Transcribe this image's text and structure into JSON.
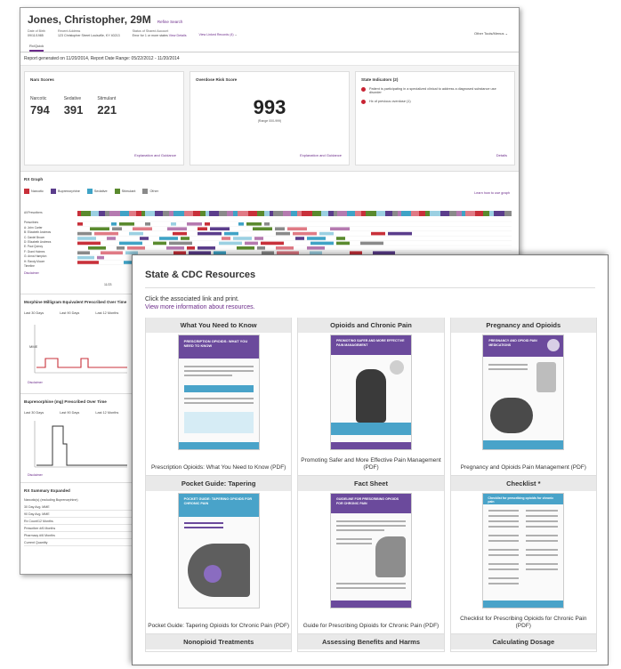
{
  "patient": {
    "name": "Jones, Christopher, 29M",
    "refine_link": "Refine Search",
    "dob_label": "Date of Birth",
    "dob": "09/11/1985",
    "address_label": "Recent Address",
    "address": "123 Christopher Street Louisville, KY 40213",
    "status_label": "Status of Shared Account",
    "status": "Error for 1 or more states",
    "view_details": "View Details",
    "linked_records": "View Linked Records (4)",
    "other_tools": "Other Tools/Menus",
    "tab": "Rx/Quick"
  },
  "report_line": "Report generated on 11/20/2014, Report Date Range: 05/22/2012 - 11/20/2014",
  "narx": {
    "title": "Narx Scores",
    "scores": [
      {
        "label": "Narcotic",
        "value": "794"
      },
      {
        "label": "Sedative",
        "value": "391"
      },
      {
        "label": "Stimulant",
        "value": "221"
      }
    ],
    "link": "Explanation and Guidance"
  },
  "overdose": {
    "title": "Overdose Risk Score",
    "value": "993",
    "range": "(Range 000-999)",
    "link": "Explanation and Guidance"
  },
  "state_indicators": {
    "title": "State Indicators (2)",
    "items": [
      "Patient is participating in a specialized clinical to address a diagnosed substance use disorder",
      "Hx of previous overdose (1)"
    ],
    "link": "Details"
  },
  "rx_graph": {
    "title": "RX Graph",
    "legend": [
      {
        "label": "Narcotic",
        "color": "#c8303a"
      },
      {
        "label": "Buprenorphine",
        "color": "#5b3d8c"
      },
      {
        "label": "Sedative",
        "color": "#3fa3c6"
      },
      {
        "label": "Stimulant",
        "color": "#5a8a2e"
      },
      {
        "label": "Other",
        "color": "#8a8a8a"
      }
    ],
    "learn_link": "Learn how to use graph",
    "all_label": "All Prescribers",
    "prescriber_header": "Prescribers",
    "prescribers": [
      "A: John Carter",
      "B: Elizabeth Andrews",
      "C: Daniel Brown",
      "D: Elizabeth Andrews",
      "E: Paul Quincy",
      "F: Grant Holmes",
      "G: Anna Hampton",
      "H: Randy Moore"
    ],
    "timeline_label": "Timeline",
    "timeline_year": "11/23",
    "disclaimer": "Disclaimer"
  },
  "mme": {
    "title": "Morphine Milligram Equivalent Prescribed Over Time",
    "tabs": [
      "Last 30 Days",
      "Last 90 Days",
      "Last 12 Months"
    ],
    "y_label": "MME",
    "disclaimer": "Disclaimer"
  },
  "buprenorphine": {
    "title": "Buprenorphine (mg) Prescribed Over Time",
    "tabs": [
      "Last 30 Days",
      "Last 90 Days",
      "Last 12 Months"
    ],
    "disclaimer": "Disclaimer"
  },
  "rx_summary": {
    "title": "RX Summary Expanded",
    "sub": "Narcotic(s) (excluding Buprenorphine)",
    "rows": [
      "30 Day Avg. MME",
      "90 Day Avg. MME",
      "Rx Count/12 Months",
      "Prescriber #/6 Months",
      "Pharmacy #/6 Months",
      "Current Quantity"
    ]
  },
  "resources": {
    "title": "State & CDC Resources",
    "instruction": "Click the associated link and print.",
    "more_link": "View more information about resources.",
    "cards": [
      {
        "heading": "What You Need to Know",
        "caption": "Prescription Opioids: What You Need to Know (PDF)",
        "thumb_title": "PRESCRIPTION OPIOIDS: WHAT YOU NEED TO KNOW",
        "accent": "#6b4a9c"
      },
      {
        "heading": "Opioids and Chronic Pain",
        "caption": "Promoting Safer and More Effective Pain Management (PDF)",
        "thumb_title": "PROMOTING SAFER AND MORE EFFECTIVE PAIN MANAGEMENT",
        "accent": "#6b4a9c"
      },
      {
        "heading": "Pregnancy and Opioids",
        "caption": "Pregnancy and Opioids Pain Management (PDF)",
        "thumb_title": "PREGNANCY AND OPIOID PAIN MEDICATIONS",
        "accent": "#6b4a9c"
      },
      {
        "heading": "Pocket Guide: Tapering",
        "caption": "Pocket Guide: Tapering Opioids for Chronic Pain (PDF)",
        "thumb_title": "POCKET GUIDE: TAPERING OPIOIDS FOR CHRONIC PAIN",
        "accent": "#49a3c9"
      },
      {
        "heading": "Fact Sheet",
        "caption": "Guide for Prescribing Opioids for Chronic Pain (PDF)",
        "thumb_title": "GUIDELINE FOR PRESCRIBING OPIOIDS FOR CHRONIC PAIN",
        "accent": "#6b4a9c"
      },
      {
        "heading": "Checklist *",
        "caption": "Checklist for Prescribing Opioids for Chronic Pain (PDF)",
        "thumb_title": "Checklist for prescribing opioids for chronic pain",
        "accent": "#49a3c9"
      }
    ],
    "row3": [
      "Nonopioid Treatments",
      "Assessing Benefits and Harms",
      "Calculating Dosage"
    ]
  }
}
